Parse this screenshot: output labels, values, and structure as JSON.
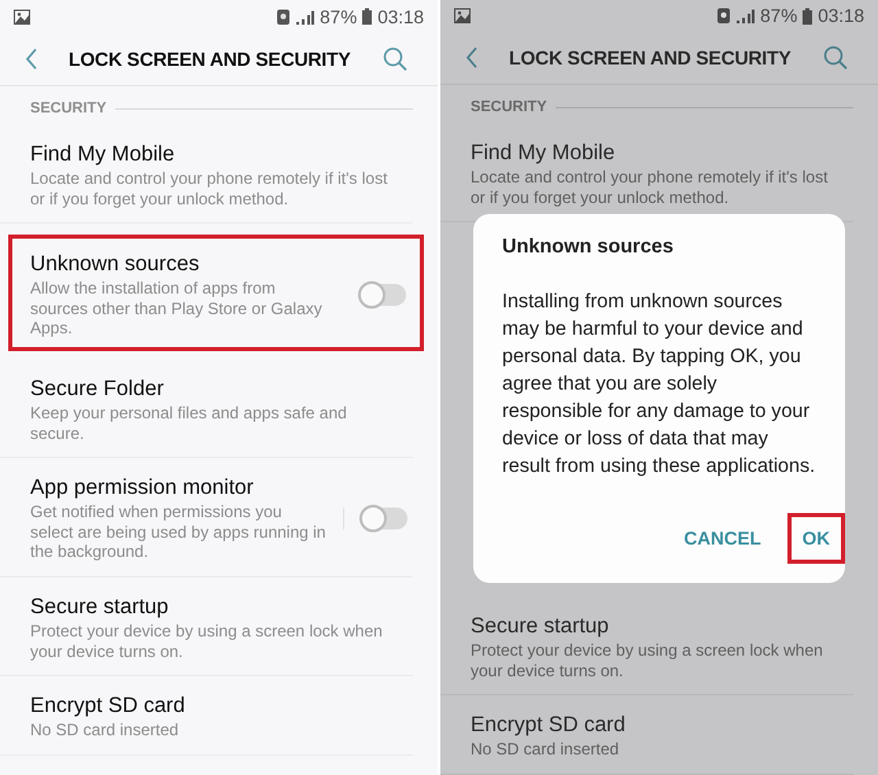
{
  "screens": [
    {
      "dimmed": false,
      "status_bar": {
        "battery_percent": "87%",
        "time": "03:18"
      },
      "header": {
        "title": "LOCK SCREEN AND SECURITY"
      },
      "section": "SECURITY",
      "items": [
        {
          "title": "Find My Mobile",
          "description": "Locate and control your phone remotely if it's lost or if you forget your unlock method.",
          "highlighted": false
        },
        {
          "title": "Unknown sources",
          "description": "Allow the installation of apps from sources other than Play Store or Galaxy Apps.",
          "highlighted": true,
          "toggle": {
            "on": false
          }
        },
        {
          "title": "Secure Folder",
          "description": "Keep your personal files and apps safe and secure.",
          "highlighted": false
        },
        {
          "title": "App permission monitor",
          "description": "Get notified when permissions you select are being used by apps running in the background.",
          "highlighted": false,
          "toggle": {
            "on": false
          }
        },
        {
          "title": "Secure startup",
          "description": "Protect your device by using a screen lock when your device turns on.",
          "highlighted": false
        },
        {
          "title": "Encrypt SD card",
          "description": "No SD card inserted",
          "highlighted": false
        }
      ]
    },
    {
      "dimmed": true,
      "status_bar": {
        "battery_percent": "87%",
        "time": "03:18"
      },
      "header": {
        "title": "LOCK SCREEN AND SECURITY"
      },
      "section": "SECURITY",
      "items": [
        {
          "title": "Find My Mobile",
          "description": "Locate and control your phone remotely if it's lost or if you forget your unlock method.",
          "highlighted": false
        }
      ],
      "dialog": {
        "title": "Unknown sources",
        "message": "Installing from unknown sources may be harmful to your device and personal data. By tapping OK, you agree that you are solely responsible for any damage to your device or loss of data that may result from using these applications.",
        "buttons": [
          {
            "label": "CANCEL",
            "highlighted": false
          },
          {
            "label": "OK",
            "highlighted": true
          }
        ]
      },
      "items_below": [
        {
          "title": "Secure startup",
          "description": "Protect your device by using a screen lock when your device turns on.",
          "highlighted": false
        },
        {
          "title": "Encrypt SD card",
          "description": "No SD card inserted",
          "highlighted": false
        }
      ]
    }
  ]
}
